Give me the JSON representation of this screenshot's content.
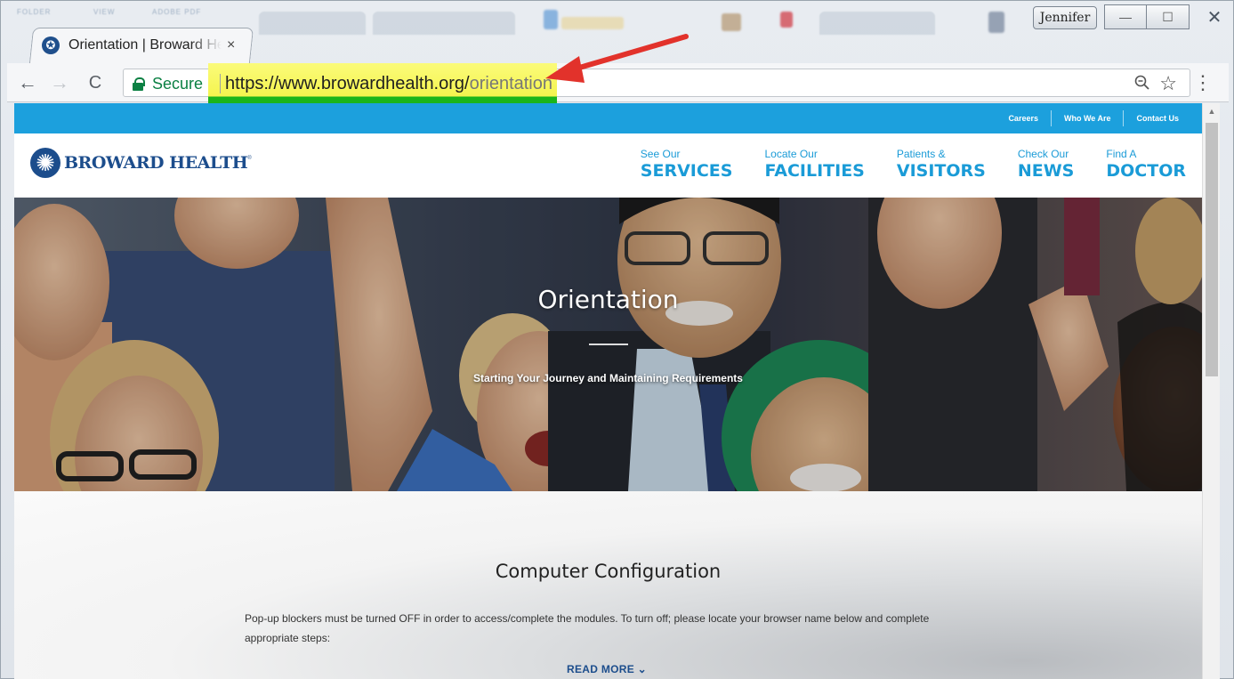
{
  "browser": {
    "tab_title": "Orientation | Broward He",
    "tab_close": "×",
    "user_name": "Jennifer",
    "secure_label": "Secure",
    "url_host": "https://www.browardhealth.org/",
    "url_path": "orientation",
    "back": "←",
    "forward": "→",
    "reload": "C",
    "menu": "⋮",
    "win_minimize": "—",
    "win_maximize": "☐",
    "win_close": "✕"
  },
  "site": {
    "top_links": [
      "Careers",
      "Who We Are",
      "Contact Us"
    ],
    "logo_text": "BROWARD HEALTH",
    "logo_mark": "®",
    "nav": [
      {
        "small": "See Our",
        "big": "SERVICES"
      },
      {
        "small": "Locate Our",
        "big": "FACILITIES"
      },
      {
        "small": "Patients &",
        "big": "VISITORS"
      },
      {
        "small": "Check Our",
        "big": "NEWS"
      },
      {
        "small": "Find A",
        "big": "DOCTOR"
      }
    ],
    "hero": {
      "title": "Orientation",
      "subtitle": "Starting Your Journey and Maintaining Requirements"
    },
    "section": {
      "title": "Computer Configuration",
      "body": "Pop-up blockers must be turned OFF in order to access/complete the modules. To turn off; please locate your browser name below and complete appropriate steps:",
      "read_more": "READ MORE ⌄"
    }
  },
  "colors": {
    "brand_blue": "#1c4d8c",
    "accent_blue": "#1ca0dd",
    "secure_green": "#0b8043",
    "highlight_yellow": "#f4f44e",
    "annotation_red": "#e2322b"
  }
}
